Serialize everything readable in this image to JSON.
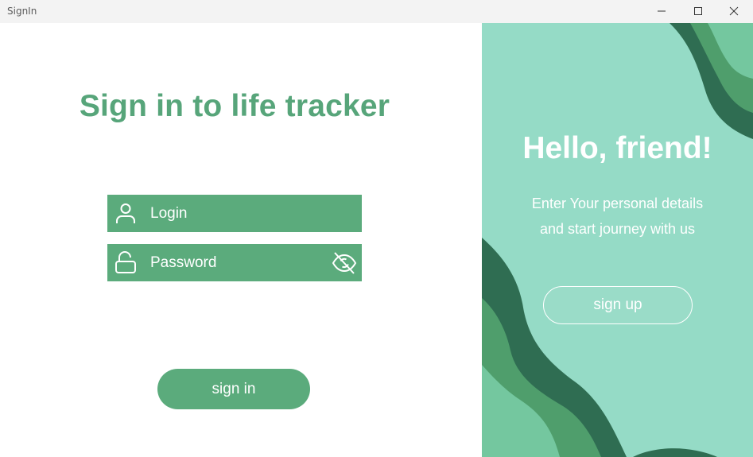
{
  "window": {
    "title": "SignIn",
    "controls": [
      "minimize-icon",
      "maximize-icon",
      "close-icon"
    ]
  },
  "signin": {
    "heading": "Sign in to life tracker",
    "login": {
      "label": "Login",
      "icon": "user-icon"
    },
    "password": {
      "label": "Password",
      "icon": "unlock-icon",
      "toggle_icon": "eye-off-icon"
    },
    "button": "sign in"
  },
  "signup_panel": {
    "heading": "Hello, friend!",
    "line1": "Enter Your personal details",
    "line2": "and start journey with us",
    "button": "sign up"
  },
  "colors": {
    "accent": "#5bab7c",
    "heading": "#57a57a",
    "panel": "#95dbc6",
    "wave_dark": "#2f6d52",
    "wave_mid": "#4f9e6c",
    "wave_light": "#74c79f"
  }
}
